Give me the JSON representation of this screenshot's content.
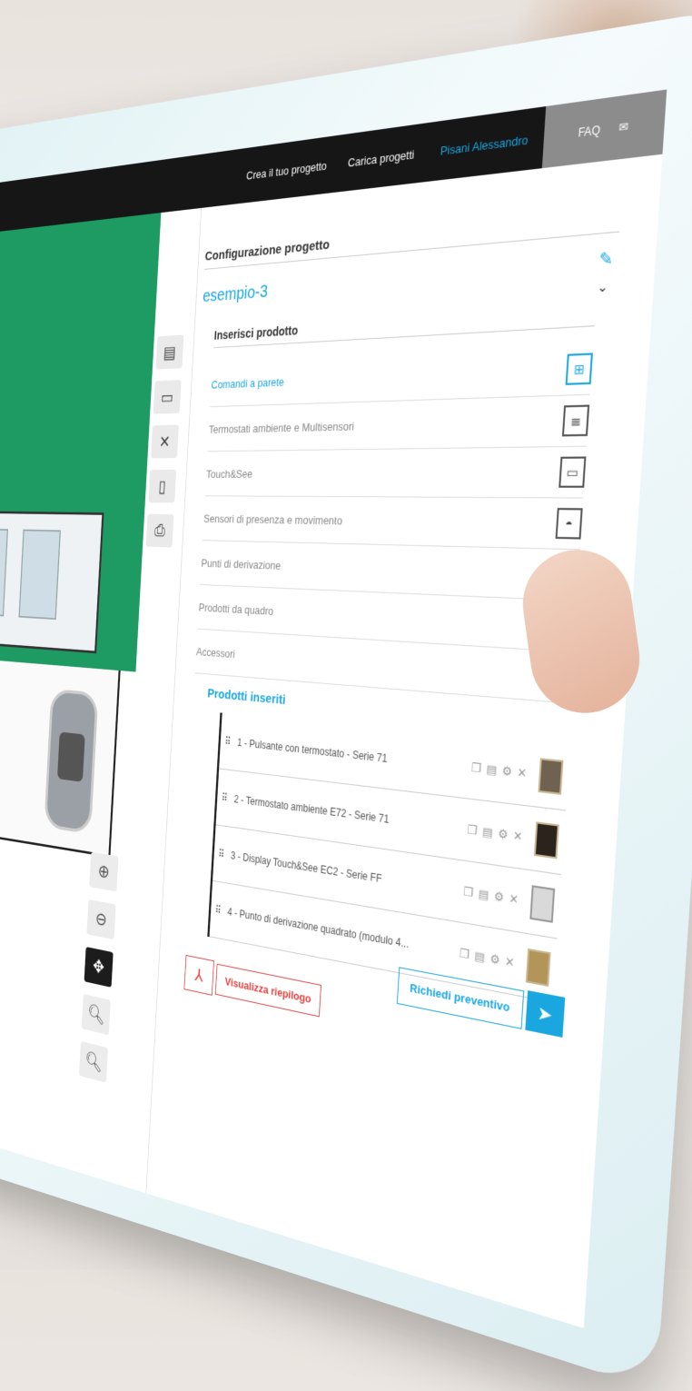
{
  "nav": {
    "links": [
      "Crea il tuo progetto",
      "Carica progetti"
    ],
    "user": "Pisani Alessandro",
    "faq": "FAQ"
  },
  "config": {
    "title": "Configurazione progetto",
    "project_name": "esempio-3"
  },
  "insert": {
    "title": "Inserisci prodotto",
    "categories": [
      {
        "label": "Comandi a parete",
        "icon": "grid-icon"
      },
      {
        "label": "Termostati ambiente e Multisensori",
        "icon": "thermostat-icon"
      },
      {
        "label": "Touch&See",
        "icon": "display-icon"
      },
      {
        "label": "Sensori di presenza e movimento",
        "icon": "sensor-icon"
      },
      {
        "label": "Punti di derivazione",
        "icon": "junction-icon"
      },
      {
        "label": "Prodotti da quadro",
        "icon": "panel-icon"
      },
      {
        "label": "Accessori",
        "icon": "accessory-icon"
      }
    ]
  },
  "inserted": {
    "title": "Prodotti inseriti",
    "items": [
      {
        "label": "1 - Pulsante con termostato - Serie 71"
      },
      {
        "label": "2 - Termostato ambiente E72 - Serie 71"
      },
      {
        "label": "3 - Display Touch&See EC2 - Serie FF"
      },
      {
        "label": "4 - Punto di derivazione quadrato (modulo 4..."
      }
    ]
  },
  "actions": {
    "summary": "Visualizza riepilogo",
    "quote": "Richiedi preventivo"
  },
  "colors": {
    "accent": "#1aa7e0",
    "danger": "#e34040",
    "canvas_green": "#1e9a63"
  }
}
